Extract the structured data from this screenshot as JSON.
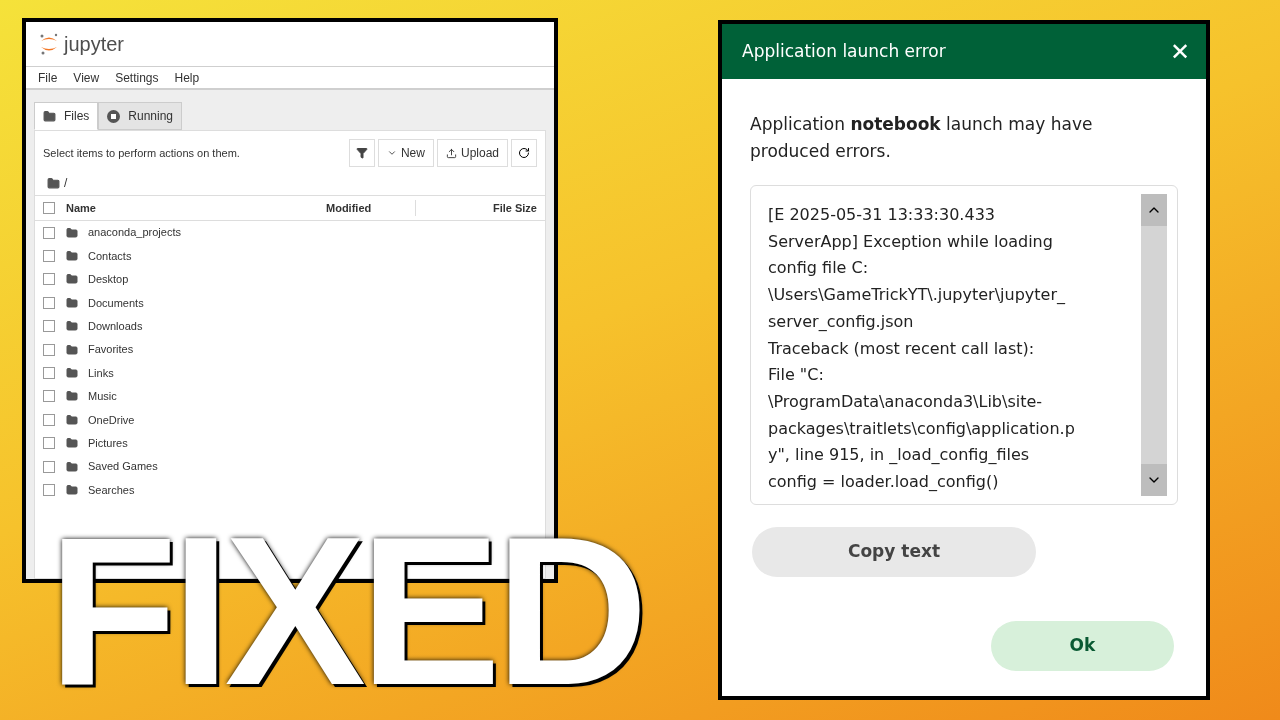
{
  "jupyter": {
    "logo": "jupyter",
    "menu": [
      "File",
      "View",
      "Settings",
      "Help"
    ],
    "tabs": [
      {
        "label": "Files",
        "selected": true
      },
      {
        "label": "Running",
        "selected": false
      }
    ],
    "hint": "Select items to perform actions on them.",
    "toolbar": {
      "new": "New",
      "upload": "Upload"
    },
    "path": "/",
    "columns": [
      "Name",
      "Modified",
      "File Size"
    ],
    "all_checked": false,
    "rows": [
      {
        "name": "anaconda_projects",
        "checked": false
      },
      {
        "name": "Contacts",
        "checked": false
      },
      {
        "name": "Desktop",
        "checked": false
      },
      {
        "name": "Documents",
        "checked": false
      },
      {
        "name": "Downloads",
        "checked": false
      },
      {
        "name": "Favorites",
        "checked": false
      },
      {
        "name": "Links",
        "checked": false
      },
      {
        "name": "Music",
        "checked": false
      },
      {
        "name": "OneDrive",
        "checked": false
      },
      {
        "name": "Pictures",
        "checked": false
      },
      {
        "name": "Saved Games",
        "checked": false
      },
      {
        "name": "Searches",
        "checked": false
      }
    ]
  },
  "dialog": {
    "title": "Application launch error",
    "close": "✕",
    "message": "Application **notebook** launch may have produced errors.",
    "log_lines": [
      "[E 2025-05-31 13:33:30.433",
      "ServerApp] Exception while loading",
      "config file C:",
      "\\Users\\GameTrickYT\\.jupyter\\jupyter_",
      "server_config.json",
      "Traceback (most recent call last):",
      "File \"C:",
      "\\ProgramData\\anaconda3\\Lib\\site-",
      "packages\\traitlets\\config\\application.p",
      "y\", line 915, in _load_config_files",
      "config = loader.load_config()"
    ],
    "copy_button": "Copy text",
    "ok_button": "Ok"
  },
  "overlay_title": "FIXED"
}
